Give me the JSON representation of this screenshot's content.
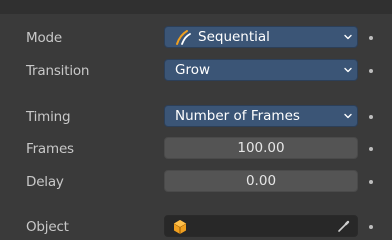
{
  "rows": {
    "mode": {
      "label": "Mode",
      "value": "Sequential",
      "icon": "stroke-sequence-icon"
    },
    "transition": {
      "label": "Transition",
      "value": "Grow"
    },
    "timing": {
      "label": "Timing",
      "value": "Number of Frames"
    },
    "frames": {
      "label": "Frames",
      "value": "100.00"
    },
    "delay": {
      "label": "Delay",
      "value": "0.00"
    },
    "object": {
      "label": "Object",
      "value": "",
      "icon": "object-cube-icon",
      "picker_icon": "eyedropper-icon"
    }
  },
  "colors": {
    "panel_bg": "#3a3a3a",
    "dropdown_bg": "#3b5576",
    "number_field_bg": "#545454",
    "object_field_bg": "#282828",
    "cube_accent": "#f0a020"
  }
}
